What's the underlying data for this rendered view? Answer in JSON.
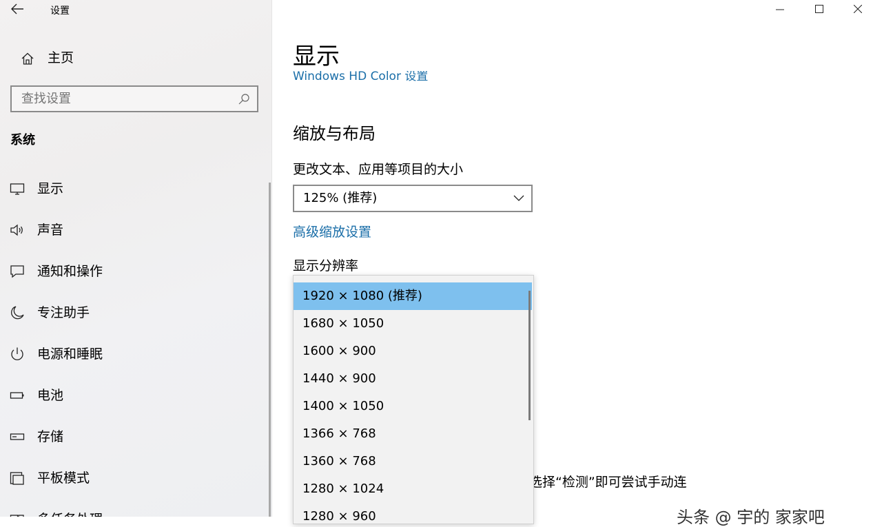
{
  "window": {
    "title": "设置"
  },
  "sidebar": {
    "home_label": "主页",
    "search_placeholder": "查找设置",
    "section": "系统",
    "items": [
      {
        "label": "显示",
        "icon": "monitor-icon"
      },
      {
        "label": "声音",
        "icon": "speaker-icon"
      },
      {
        "label": "通知和操作",
        "icon": "notification-icon"
      },
      {
        "label": "专注助手",
        "icon": "moon-icon"
      },
      {
        "label": "电源和睡眠",
        "icon": "power-icon"
      },
      {
        "label": "电池",
        "icon": "battery-icon"
      },
      {
        "label": "存储",
        "icon": "storage-icon"
      },
      {
        "label": "平板模式",
        "icon": "tablet-mode-icon"
      },
      {
        "label": "多任务处理",
        "icon": "multitask-icon"
      }
    ]
  },
  "main": {
    "title": "显示",
    "hd_link": "Windows HD Color 设置",
    "scale_heading": "缩放与布局",
    "scale_label": "更改文本、应用等项目的大小",
    "scale_value": "125% (推荐)",
    "advanced_scaling_link": "高级缩放设置",
    "resolution_label": "显示分辨率",
    "behind_text": "选择“检测”即可尝试手动连",
    "watermark": "头条 @ 宇的 家家吧"
  },
  "resolution_options": [
    "1920 × 1080 (推荐)",
    "1680 × 1050",
    "1600 × 900",
    "1440 × 900",
    "1400 × 1050",
    "1366 × 768",
    "1360 × 768",
    "1280 × 1024",
    "1280 × 960"
  ],
  "selected_resolution": "1920 × 1080 (推荐)",
  "colors": {
    "accent_link": "#1a6ea8",
    "selection": "#7ec0ee"
  }
}
